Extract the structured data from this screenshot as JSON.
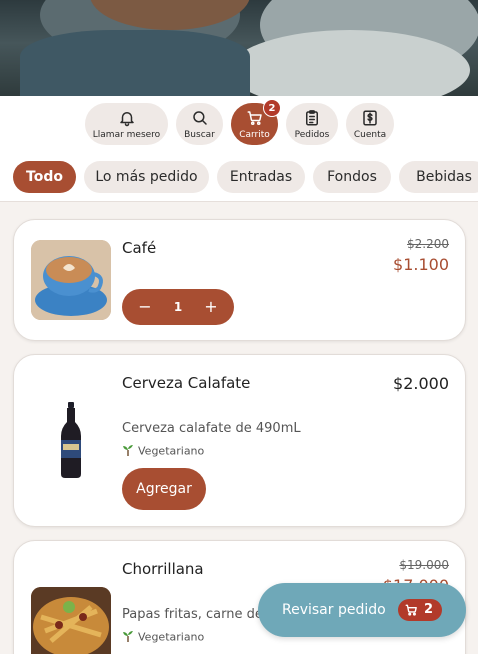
{
  "actions": [
    {
      "label": "Llamar mesero",
      "icon": "bell-icon"
    },
    {
      "label": "Buscar",
      "icon": "search-icon"
    },
    {
      "label": "Carrito",
      "icon": "cart-icon",
      "badge": "2"
    },
    {
      "label": "Pedidos",
      "icon": "clipboard-icon"
    },
    {
      "label": "Cuenta",
      "icon": "receipt-icon"
    }
  ],
  "categories": [
    "Todo",
    "Lo más pedido",
    "Entradas",
    "Fondos",
    "Bebidas"
  ],
  "products": [
    {
      "name": "Café",
      "price_old": "$2.200",
      "price": "$1.100",
      "quantity": "1",
      "minus": "−",
      "plus": "+"
    },
    {
      "name": "Cerveza Calafate",
      "price": "$2.000",
      "desc": "Cerveza calafate de 490mL",
      "tag": "Vegetariano",
      "add_label": "Agregar"
    },
    {
      "name": "Chorrillana",
      "price_old": "$19.000",
      "price": "$17.000",
      "desc": "Papas fritas, carne de",
      "tag": "Vegetariano"
    }
  ],
  "review": {
    "label": "Revisar pedido",
    "count": "2"
  },
  "colors": {
    "accent": "#a84e32",
    "badge": "#b23a2a",
    "review": "#6fa8b8",
    "chip": "#efe9e6"
  }
}
